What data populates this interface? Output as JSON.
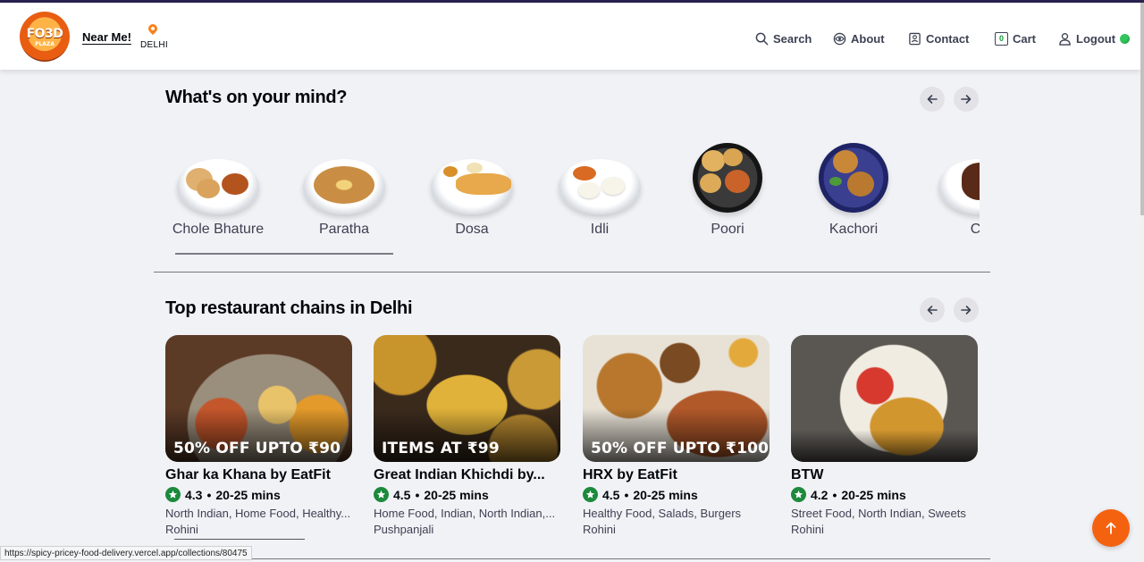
{
  "header": {
    "logo_text": "FO3D",
    "logo_sub": "PLAZA",
    "near_me": "Near Me!",
    "city": "DELHI",
    "nav": {
      "search": "Search",
      "about": "About",
      "contact": "Contact",
      "cart": "Cart",
      "cart_count": "0",
      "logout": "Logout"
    }
  },
  "mind": {
    "title": "What's on your mind?",
    "items": [
      {
        "label": "Chole Bhature"
      },
      {
        "label": "Paratha"
      },
      {
        "label": "Dosa"
      },
      {
        "label": "Idli"
      },
      {
        "label": "Poori"
      },
      {
        "label": "Kachori"
      },
      {
        "label": "Co"
      }
    ]
  },
  "chains": {
    "title": "Top restaurant chains in Delhi",
    "restaurants": [
      {
        "offer": "50% OFF UPTO ₹90",
        "name": "Ghar ka Khana by EatFit",
        "rating": "4.3",
        "time": "20-25 mins",
        "cuisine": "North Indian, Home Food, Healthy...",
        "area": "Rohini"
      },
      {
        "offer": "ITEMS AT ₹99",
        "name": "Great Indian Khichdi by...",
        "rating": "4.5",
        "time": "20-25 mins",
        "cuisine": "Home Food, Indian, North Indian,...",
        "area": "Pushpanjali"
      },
      {
        "offer": "50% OFF UPTO ₹100",
        "name": "HRX by EatFit",
        "rating": "4.5",
        "time": "20-25 mins",
        "cuisine": "Healthy Food, Salads, Burgers",
        "area": "Rohini"
      },
      {
        "offer": "",
        "name": "BTW",
        "rating": "4.2",
        "time": "20-25 mins",
        "cuisine": "Street Food, North Indian, Sweets",
        "area": "Rohini"
      }
    ]
  },
  "status_url": "https://spicy-pricey-food-delivery.vercel.app/collections/80475",
  "colors": {
    "accent": "#fc8019",
    "rating_green": "#1c8a3c",
    "fab": "#f5620f",
    "page_bg": "#f1f2f6"
  }
}
